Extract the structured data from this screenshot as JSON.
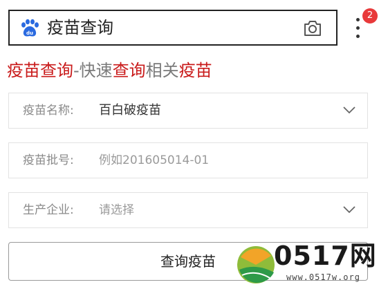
{
  "search": {
    "query": "疫苗查询"
  },
  "badge": {
    "count": "2"
  },
  "heading": {
    "part1": "疫苗查询",
    "part2": "-快速",
    "part3": "查询",
    "part4": "相关",
    "part5": "疫苗"
  },
  "form": {
    "name": {
      "label": "疫苗名称:",
      "value": "百白破疫苗"
    },
    "batch": {
      "label": "疫苗批号:",
      "placeholder": "例如201605014-01"
    },
    "company": {
      "label": "生产企业:",
      "placeholder": "请选择"
    }
  },
  "button": {
    "label": "查询疫苗"
  },
  "watermark": {
    "brand": "0517网",
    "url": "www.0517w.org"
  },
  "colors": {
    "accent_red": "#c91a1a",
    "badge_red": "#e8393a"
  },
  "icons": [
    "baidu-paw-icon",
    "camera-icon",
    "more-menu-icon",
    "chevron-down-icon"
  ]
}
